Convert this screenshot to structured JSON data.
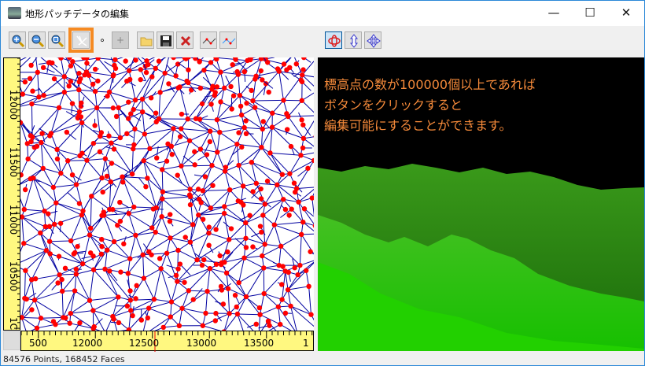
{
  "window": {
    "title": "地形パッチデータの編集",
    "minimize": "—",
    "maximize": "☐",
    "close": "✕"
  },
  "toolbar": {
    "buttons": [
      {
        "name": "zoom-in-icon"
      },
      {
        "name": "zoom-out-icon"
      },
      {
        "name": "zoom-fit-icon"
      },
      {
        "name": "mesh-edit-icon",
        "highlighted": true
      },
      {
        "name": "point-mode",
        "label": "∘"
      },
      {
        "name": "add-point",
        "label": "+"
      },
      {
        "name": "open-folder-icon"
      },
      {
        "name": "save-icon"
      },
      {
        "name": "delete-icon"
      },
      {
        "name": "line-red-icon"
      },
      {
        "name": "line-blue-icon"
      },
      {
        "name": "rotate-icon",
        "active": true
      },
      {
        "name": "move-vertical-icon"
      },
      {
        "name": "move-all-icon"
      }
    ]
  },
  "plot": {
    "x_ticks": [
      "12000",
      "12500",
      "13000",
      "13500"
    ],
    "x_edge_left": "500",
    "x_edge_right": "1",
    "y_ticks": [
      "12000",
      "11500",
      "11000",
      "10500"
    ],
    "y_edge_bottom": "1C",
    "edge_color": "#0000a0",
    "point_color": "#ff0000",
    "axis_bg": "#fff880"
  },
  "view3d": {
    "overlay_text": "標高点の数が100000個以上であれば\nボタンをクリックすると\n編集可能にすることができます。",
    "overlay_color": "#f58a3a"
  },
  "status": {
    "text": "84576 Points, 168452 Faces"
  }
}
